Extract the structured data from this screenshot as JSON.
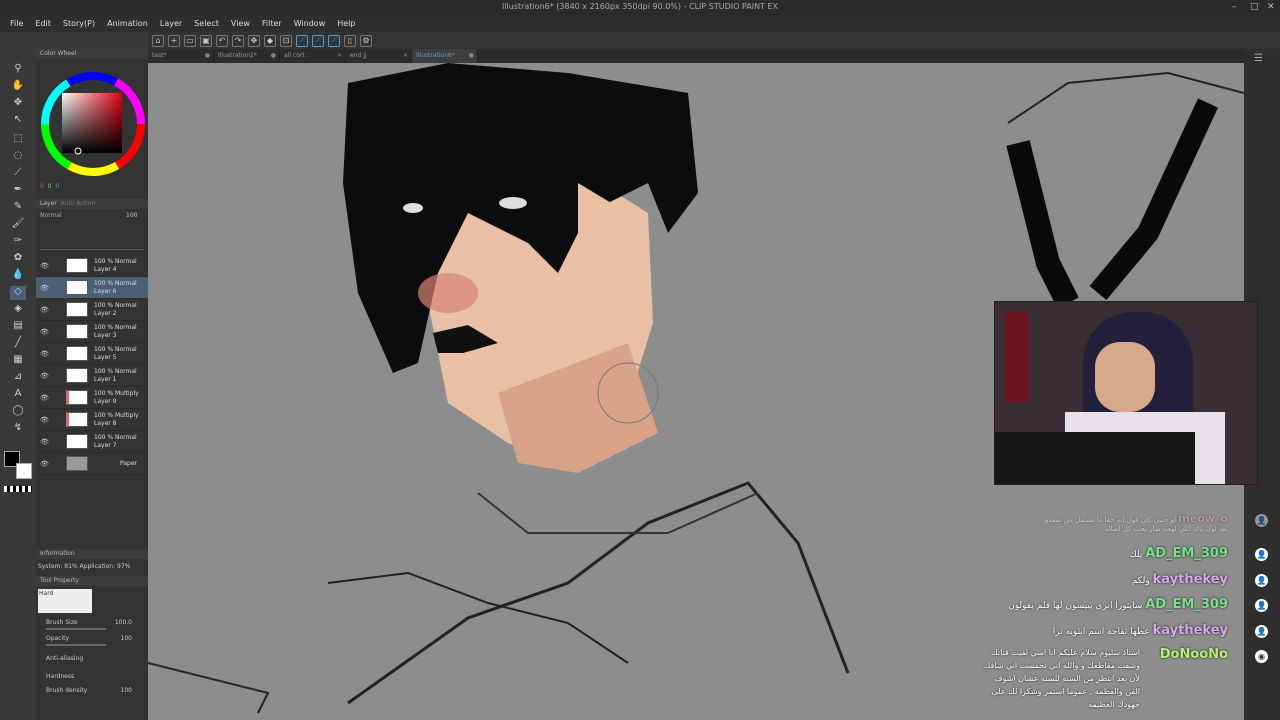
{
  "window": {
    "title": "Illustration6* (3840 x 2160px 350dpi 90.0%) - CLIP STUDIO PAINT EX"
  },
  "menu": [
    "File",
    "Edit",
    "Story(P)",
    "Animation",
    "Layer",
    "Select",
    "View",
    "Filter",
    "Window",
    "Help"
  ],
  "tabs": [
    {
      "label": "test*",
      "active": false
    },
    {
      "label": "Illustration2*",
      "active": false
    },
    {
      "label": "all cort",
      "active": false
    },
    {
      "label": "end jj",
      "active": false
    },
    {
      "label": "Illustration6*",
      "active": true
    }
  ],
  "color_panel": {
    "title": "Color Wheel",
    "rgb": [
      "0",
      "0",
      "0"
    ]
  },
  "layer_panel": {
    "title": "Layer",
    "subtitle": "Auto Action",
    "blend": "Normal",
    "opacity": "100",
    "layers": [
      {
        "mode": "100 % Normal",
        "name": "Layer 4",
        "selected": false
      },
      {
        "mode": "100 % Normal",
        "name": "Layer 6",
        "selected": true
      },
      {
        "mode": "100 % Normal",
        "name": "Layer 2",
        "selected": false
      },
      {
        "mode": "100 % Normal",
        "name": "Layer 3",
        "selected": false
      },
      {
        "mode": "100 % Normal",
        "name": "Layer 5",
        "selected": false
      },
      {
        "mode": "100 % Normal",
        "name": "Layer 1",
        "selected": false
      },
      {
        "mode": "100 % Multiply",
        "name": "Layer 9",
        "selected": false
      },
      {
        "mode": "100 % Multiply",
        "name": "Layer 8",
        "selected": false
      },
      {
        "mode": "100 % Normal",
        "name": "Layer 7",
        "selected": false
      },
      {
        "mode": "",
        "name": "Paper",
        "selected": false
      }
    ]
  },
  "info_panel": {
    "title": "Information",
    "text": "System: 81% Application: 97%"
  },
  "tool_property": {
    "title": "Tool Property",
    "brush_label": "Hard",
    "rows": [
      {
        "label": "Brush Size",
        "value": "100.0"
      },
      {
        "label": "Opacity",
        "value": "100"
      },
      {
        "label": "Anti-aliasing",
        "value": ""
      },
      {
        "label": "Hardness",
        "value": ""
      },
      {
        "label": "Brush density",
        "value": "100"
      }
    ]
  },
  "chat": {
    "messages": [
      {
        "name": "meow_o",
        "text": "لو جنبي كان قول انه حقا ما يشتغل عن سعدو",
        "text2": "بعد لوك ياك اللي لهجه صار يحب كل اصاله",
        "color": "#e9a0b0",
        "faded": true
      },
      {
        "name": "AD_EM_309",
        "text": "يلك",
        "color": "#7be08a"
      },
      {
        "name": "kaythekey",
        "text": "ولكم",
        "color": "#d9a9f0"
      },
      {
        "name": "AD_EM_309",
        "text": "سايتورا ابري يبيسون لها قلم يقولون",
        "color": "#7be08a"
      },
      {
        "name": "kaythekey",
        "text": "عطها تفاحة اسم انثويه ترا",
        "color": "#d9a9f0"
      },
      {
        "name": "DoNooNo",
        "text": "استاذ سليوم سلام عليكم انا اسي لقيت قناتك",
        "text2": "وشفت مقاطعك و والله اني تحمست اني شافك",
        "text3": "لأن بعد انتظر من السنه للسنه عشان اشوف",
        "text4": "الفن والعظمه , عموما استمر وشكرا لك على",
        "text5": "جهودك العظيمه",
        "color": "#b6f07a"
      }
    ]
  },
  "colors": {
    "accent": "#4a9fe0",
    "canvas": "#8d8d8d"
  }
}
